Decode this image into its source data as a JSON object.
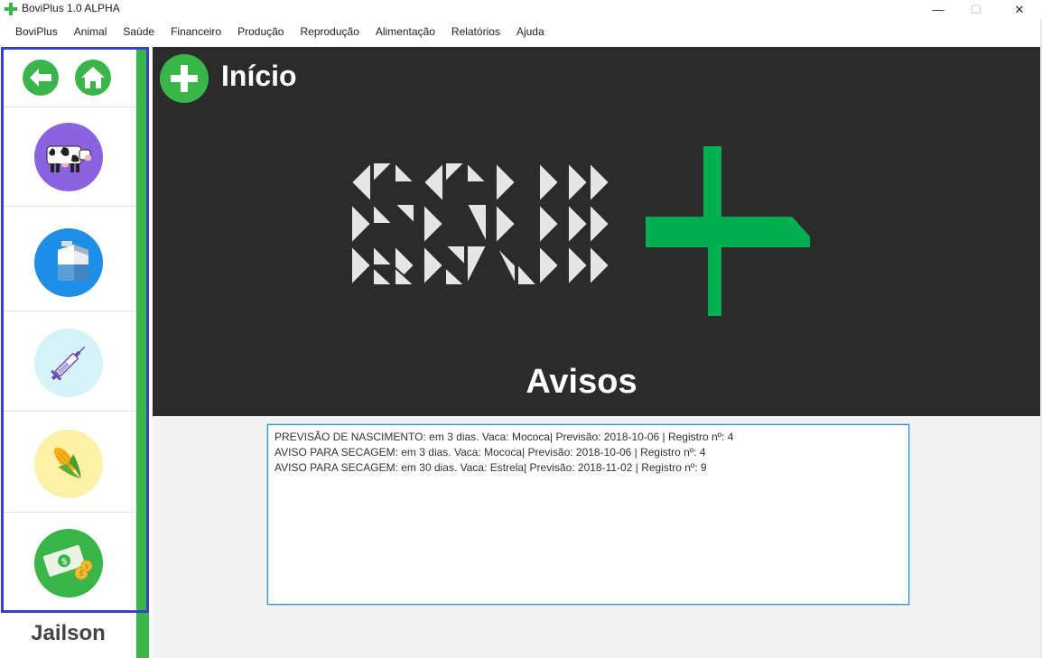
{
  "window": {
    "title": "BoviPlus 1.0 ALPHA",
    "minimize": "—",
    "maximize": "☐",
    "close": "✕"
  },
  "menu": [
    "BoviPlus",
    "Animal",
    "Saúde",
    "Financeiro",
    "Produção",
    "Reprodução",
    "Alimentação",
    "Relatórios",
    "Ajuda"
  ],
  "header": {
    "title": "Início",
    "icon": "plus-icon"
  },
  "banner": {
    "logo_alt": "BOVI+",
    "section_title": "Avisos"
  },
  "sidebar": {
    "top_buttons": [
      {
        "name": "back",
        "icon": "arrow-left-icon"
      },
      {
        "name": "home",
        "icon": "home-icon"
      }
    ],
    "items": [
      {
        "name": "animal",
        "icon": "cow-icon",
        "color": "#8a63e0"
      },
      {
        "name": "producao",
        "icon": "milk-carton-icon",
        "color": "#1e8ee6"
      },
      {
        "name": "saude",
        "icon": "syringe-icon",
        "color": "#d6f3fa"
      },
      {
        "name": "alimentacao",
        "icon": "corn-icon",
        "color": "#fdf1a8"
      },
      {
        "name": "financeiro",
        "icon": "money-icon",
        "color": "#39b54a"
      }
    ],
    "user_name": "Jailson"
  },
  "avisos": [
    "PREVISÃO DE NASCIMENTO: em 3 dias. Vaca: Mococa| Previsão: 2018-10-06 | Registro nº: 4",
    "AVISO PARA SECAGEM: em 3 dias. Vaca: Mococa| Previsão: 2018-10-06 | Registro nº: 4",
    "AVISO PARA SECAGEM: em 30 dias. Vaca: Estrela| Previsão: 2018-11-02 | Registro nº: 9"
  ],
  "colors": {
    "accent_green": "#39b54a",
    "banner_bg": "#2b2b2b",
    "sidebar_outline": "#3b3fcf",
    "logo_green": "#00b050"
  }
}
